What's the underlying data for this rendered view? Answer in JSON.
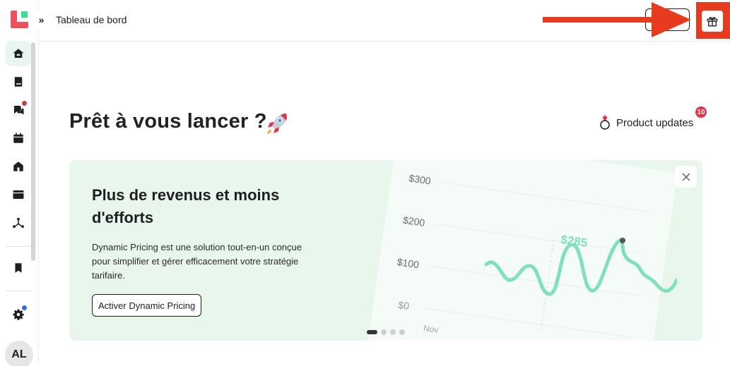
{
  "header": {
    "title": "Tableau de bord",
    "expand_label": "»"
  },
  "sidebar": {
    "items": [
      {
        "name": "home",
        "icon": "home-icon",
        "active": true
      },
      {
        "name": "bookings",
        "icon": "book-icon"
      },
      {
        "name": "messages",
        "icon": "chat-icon",
        "notification": true
      },
      {
        "name": "calendar",
        "icon": "calendar-icon"
      },
      {
        "name": "properties",
        "icon": "house-icon"
      },
      {
        "name": "browser",
        "icon": "window-icon"
      },
      {
        "name": "integrations",
        "icon": "network-icon"
      },
      {
        "name": "bookmarks",
        "icon": "bookmark-icon"
      },
      {
        "name": "settings",
        "icon": "gear-icon",
        "notification": true
      }
    ],
    "avatar_initials": "AL"
  },
  "main": {
    "title": "Prêt à vous lancer ?",
    "updates_label": "Product updates",
    "updates_count": "10"
  },
  "banner": {
    "title": "Plus de revenus et moins d'efforts",
    "text": "Dynamic Pricing est une solution tout-en-un conçue pour simplifier et gérer efficacement votre stratégie tarifaire.",
    "cta_label": "Activer Dynamic Pricing",
    "chart": {
      "tick_labels": [
        "$300",
        "$200",
        "$100",
        "$0"
      ],
      "highlight_label": "$285",
      "partial_label": "Nov"
    },
    "carousel_count": 4,
    "carousel_active": 1
  },
  "colors": {
    "accent_red": "#e63b1f",
    "banner_bg": "#e8f6ec",
    "chart_line": "#7fe0bf",
    "badge_red": "#e0344a"
  }
}
